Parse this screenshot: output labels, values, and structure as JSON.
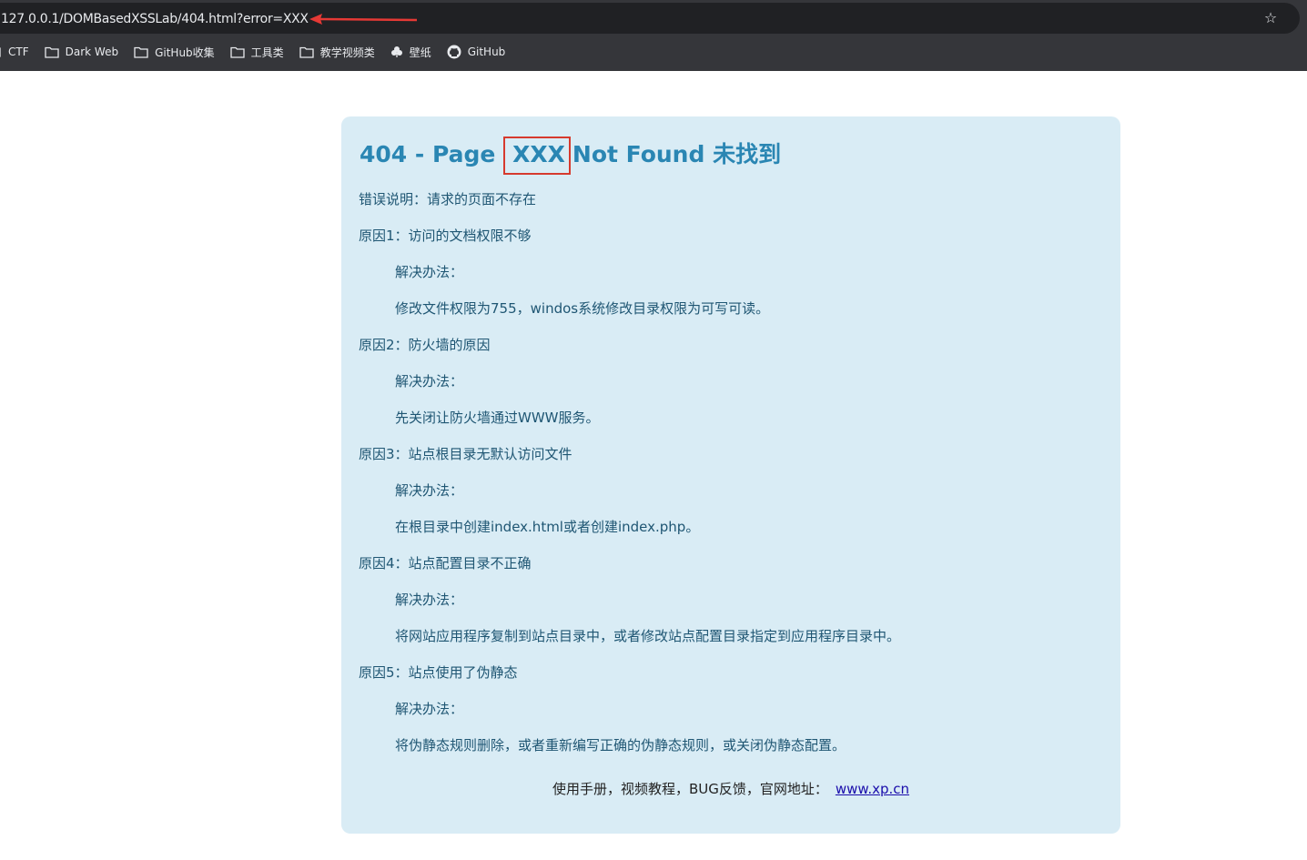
{
  "browser": {
    "url": "127.0.0.1/DOMBasedXSSLab/404.html?error=XXX",
    "bookmarks": [
      {
        "label": "CTF",
        "icon": "folder-icon"
      },
      {
        "label": "Dark Web",
        "icon": "folder-icon"
      },
      {
        "label": "GitHub收集",
        "icon": "folder-icon"
      },
      {
        "label": "工具类",
        "icon": "folder-icon"
      },
      {
        "label": "教学视频类",
        "icon": "folder-icon"
      },
      {
        "label": "壁纸",
        "icon": "clover-icon"
      },
      {
        "label": "GitHub",
        "icon": "github-icon"
      }
    ],
    "accent_arrow_color": "#e53935"
  },
  "page": {
    "title_prefix": "404 - Page",
    "title_injected": "XXX",
    "title_suffix": "Not Found 未找到",
    "error_desc": "错误说明：请求的页面不存在",
    "reasons": [
      {
        "reason": "原因1：访问的文档权限不够",
        "fix_label": "解决办法：",
        "fix": "修改文件权限为755，windos系统修改目录权限为可写可读。"
      },
      {
        "reason": "原因2：防火墙的原因",
        "fix_label": "解决办法：",
        "fix": "先关闭让防火墙通过WWW服务。"
      },
      {
        "reason": "原因3：站点根目录无默认访问文件",
        "fix_label": "解决办法：",
        "fix": "在根目录中创建index.html或者创建index.php。"
      },
      {
        "reason": "原因4：站点配置目录不正确",
        "fix_label": "解决办法：",
        "fix": "将网站应用程序复制到站点目录中，或者修改站点配置目录指定到应用程序目录中。"
      },
      {
        "reason": "原因5：站点使用了伪静态",
        "fix_label": "解决办法：",
        "fix": "将伪静态规则删除，或者重新编写正确的伪静态规则，或关闭伪静态配置。"
      }
    ],
    "footer_text": "使用手册，视频教程，BUG反馈，官网地址：",
    "footer_link": "www.xp.cn",
    "colors": {
      "panel_bg": "#d9ecf5",
      "title": "#2a86b3",
      "highlight_box": "#d63a2e"
    }
  }
}
